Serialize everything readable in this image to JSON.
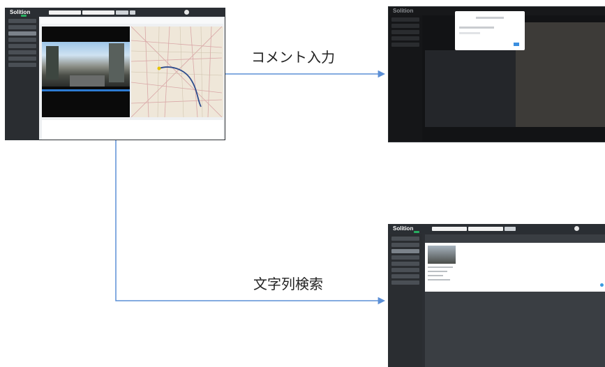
{
  "diagram": {
    "label_top": "コメント入力",
    "label_bottom": "文字列検索",
    "app_logo": "Solition",
    "arrow_color": "#5b8fd6"
  }
}
